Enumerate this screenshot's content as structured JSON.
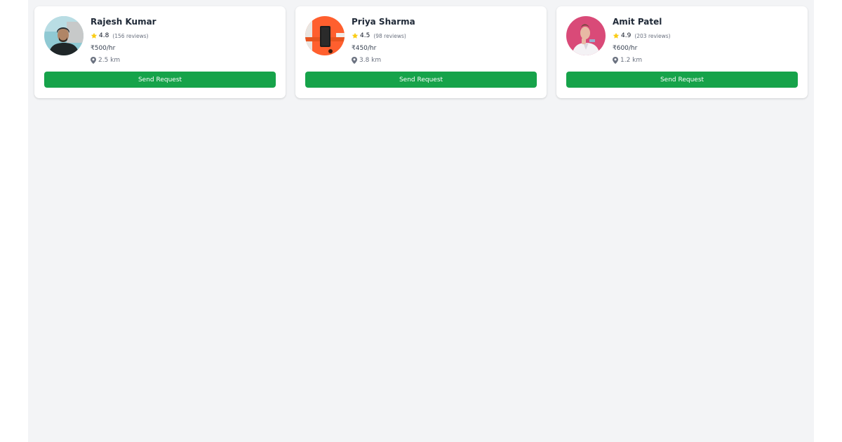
{
  "providers": [
    {
      "name": "Rajesh Kumar",
      "rating": "4.8",
      "reviews": "(156 reviews)",
      "rate": "₹500/hr",
      "distance": "2.5 km",
      "button_label": "Send Request"
    },
    {
      "name": "Priya Sharma",
      "rating": "4.5",
      "reviews": "(98 reviews)",
      "rate": "₹450/hr",
      "distance": "3.8 km",
      "button_label": "Send Request"
    },
    {
      "name": "Amit Patel",
      "rating": "4.9",
      "reviews": "(203 reviews)",
      "rate": "₹600/hr",
      "distance": "1.2 km",
      "button_label": "Send Request"
    }
  ],
  "icons": {
    "rating": "star-icon",
    "distance": "map-pin-icon"
  },
  "colors": {
    "accent": "#16a34a",
    "star": "#facc15",
    "background": "#f3f4f6"
  }
}
